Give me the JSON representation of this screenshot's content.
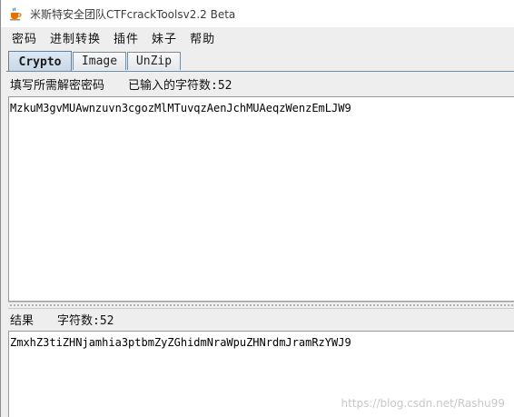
{
  "window": {
    "title": "米斯特安全团队CTFcrackToolsv2.2 Beta"
  },
  "menu": {
    "items": [
      {
        "label": "密码"
      },
      {
        "label": "进制转换"
      },
      {
        "label": "插件"
      },
      {
        "label": "妹子"
      },
      {
        "label": "帮助"
      }
    ]
  },
  "tabs": [
    {
      "label": "Crypto",
      "active": true
    },
    {
      "label": "Image",
      "active": false
    },
    {
      "label": "UnZip",
      "active": false
    }
  ],
  "input": {
    "label": "填写所需解密密码",
    "count_label": "已输入的字符数:52",
    "value": "MzkuM3gvMUAwnzuvn3cgozMlMTuvqzAenJchMUAeqzWenzEmLJW9"
  },
  "output": {
    "label": "结果",
    "count_label": "字符数:52",
    "value": "ZmxhZ3tiZHNjamhia3ptbmZyZGhidmNraWpuZHNrdmJramRzYWJ9"
  },
  "watermark": "https://blog.csdn.net/Rashu99",
  "colors": {
    "tab_active": "#c8d7e6",
    "window_bg": "#eeeeee"
  }
}
